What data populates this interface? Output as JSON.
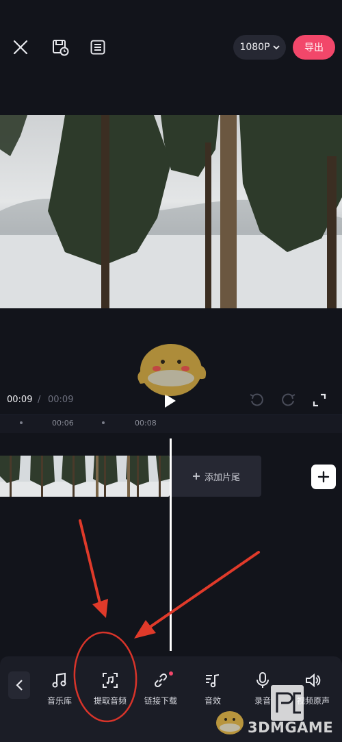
{
  "topbar": {
    "resolution_label": "1080P",
    "export_label": "导出"
  },
  "playback": {
    "current_time": "00:09",
    "separator": "/",
    "total_time": "00:09"
  },
  "timeline": {
    "ruler_labels": [
      "00:06",
      "00:08"
    ],
    "add_tail_label": "添加片尾"
  },
  "toolbar": {
    "items": [
      {
        "label": "音乐库",
        "icon": "music-note-icon"
      },
      {
        "label": "提取音频",
        "icon": "extract-audio-icon"
      },
      {
        "label": "链接下载",
        "icon": "link-icon"
      },
      {
        "label": "音效",
        "icon": "sound-effect-icon"
      },
      {
        "label": "录音",
        "icon": "microphone-icon"
      },
      {
        "label": "视频原声",
        "icon": "speaker-icon"
      }
    ]
  },
  "watermark": {
    "text": "3DMGAME"
  },
  "colors": {
    "accent": "#f2476a",
    "background": "#12141b",
    "annotation": "#e03a2a"
  }
}
